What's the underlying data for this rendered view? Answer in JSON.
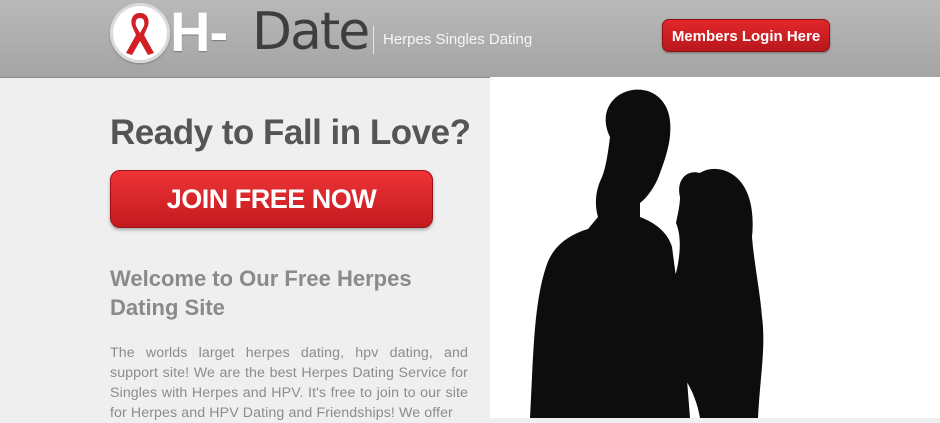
{
  "header": {
    "logo": {
      "icon": "red-ribbon-icon",
      "brand_h": "H-",
      "brand_date": "Date"
    },
    "tagline": "Herpes Singles Dating",
    "login_label": "Members Login Here"
  },
  "hero": {
    "title": "Ready to Fall in Love?",
    "join_label": "JOIN FREE NOW",
    "welcome_heading": "Welcome to Our Free Herpes Dating Site",
    "body": "The worlds larget herpes dating, hpv dating, and support site! We are the best Herpes Dating Service for Singles with Herpes and HPV. It's free to join to our site for Herpes and HPV Dating and Friendships! We offer",
    "photo": "couple-silhouette-photo"
  },
  "colors": {
    "header_bg": "#a9a9a9",
    "page_bg": "#efefef",
    "accent_red": "#d42126",
    "title_text": "#555555",
    "heading_text": "#8a8a8a"
  }
}
